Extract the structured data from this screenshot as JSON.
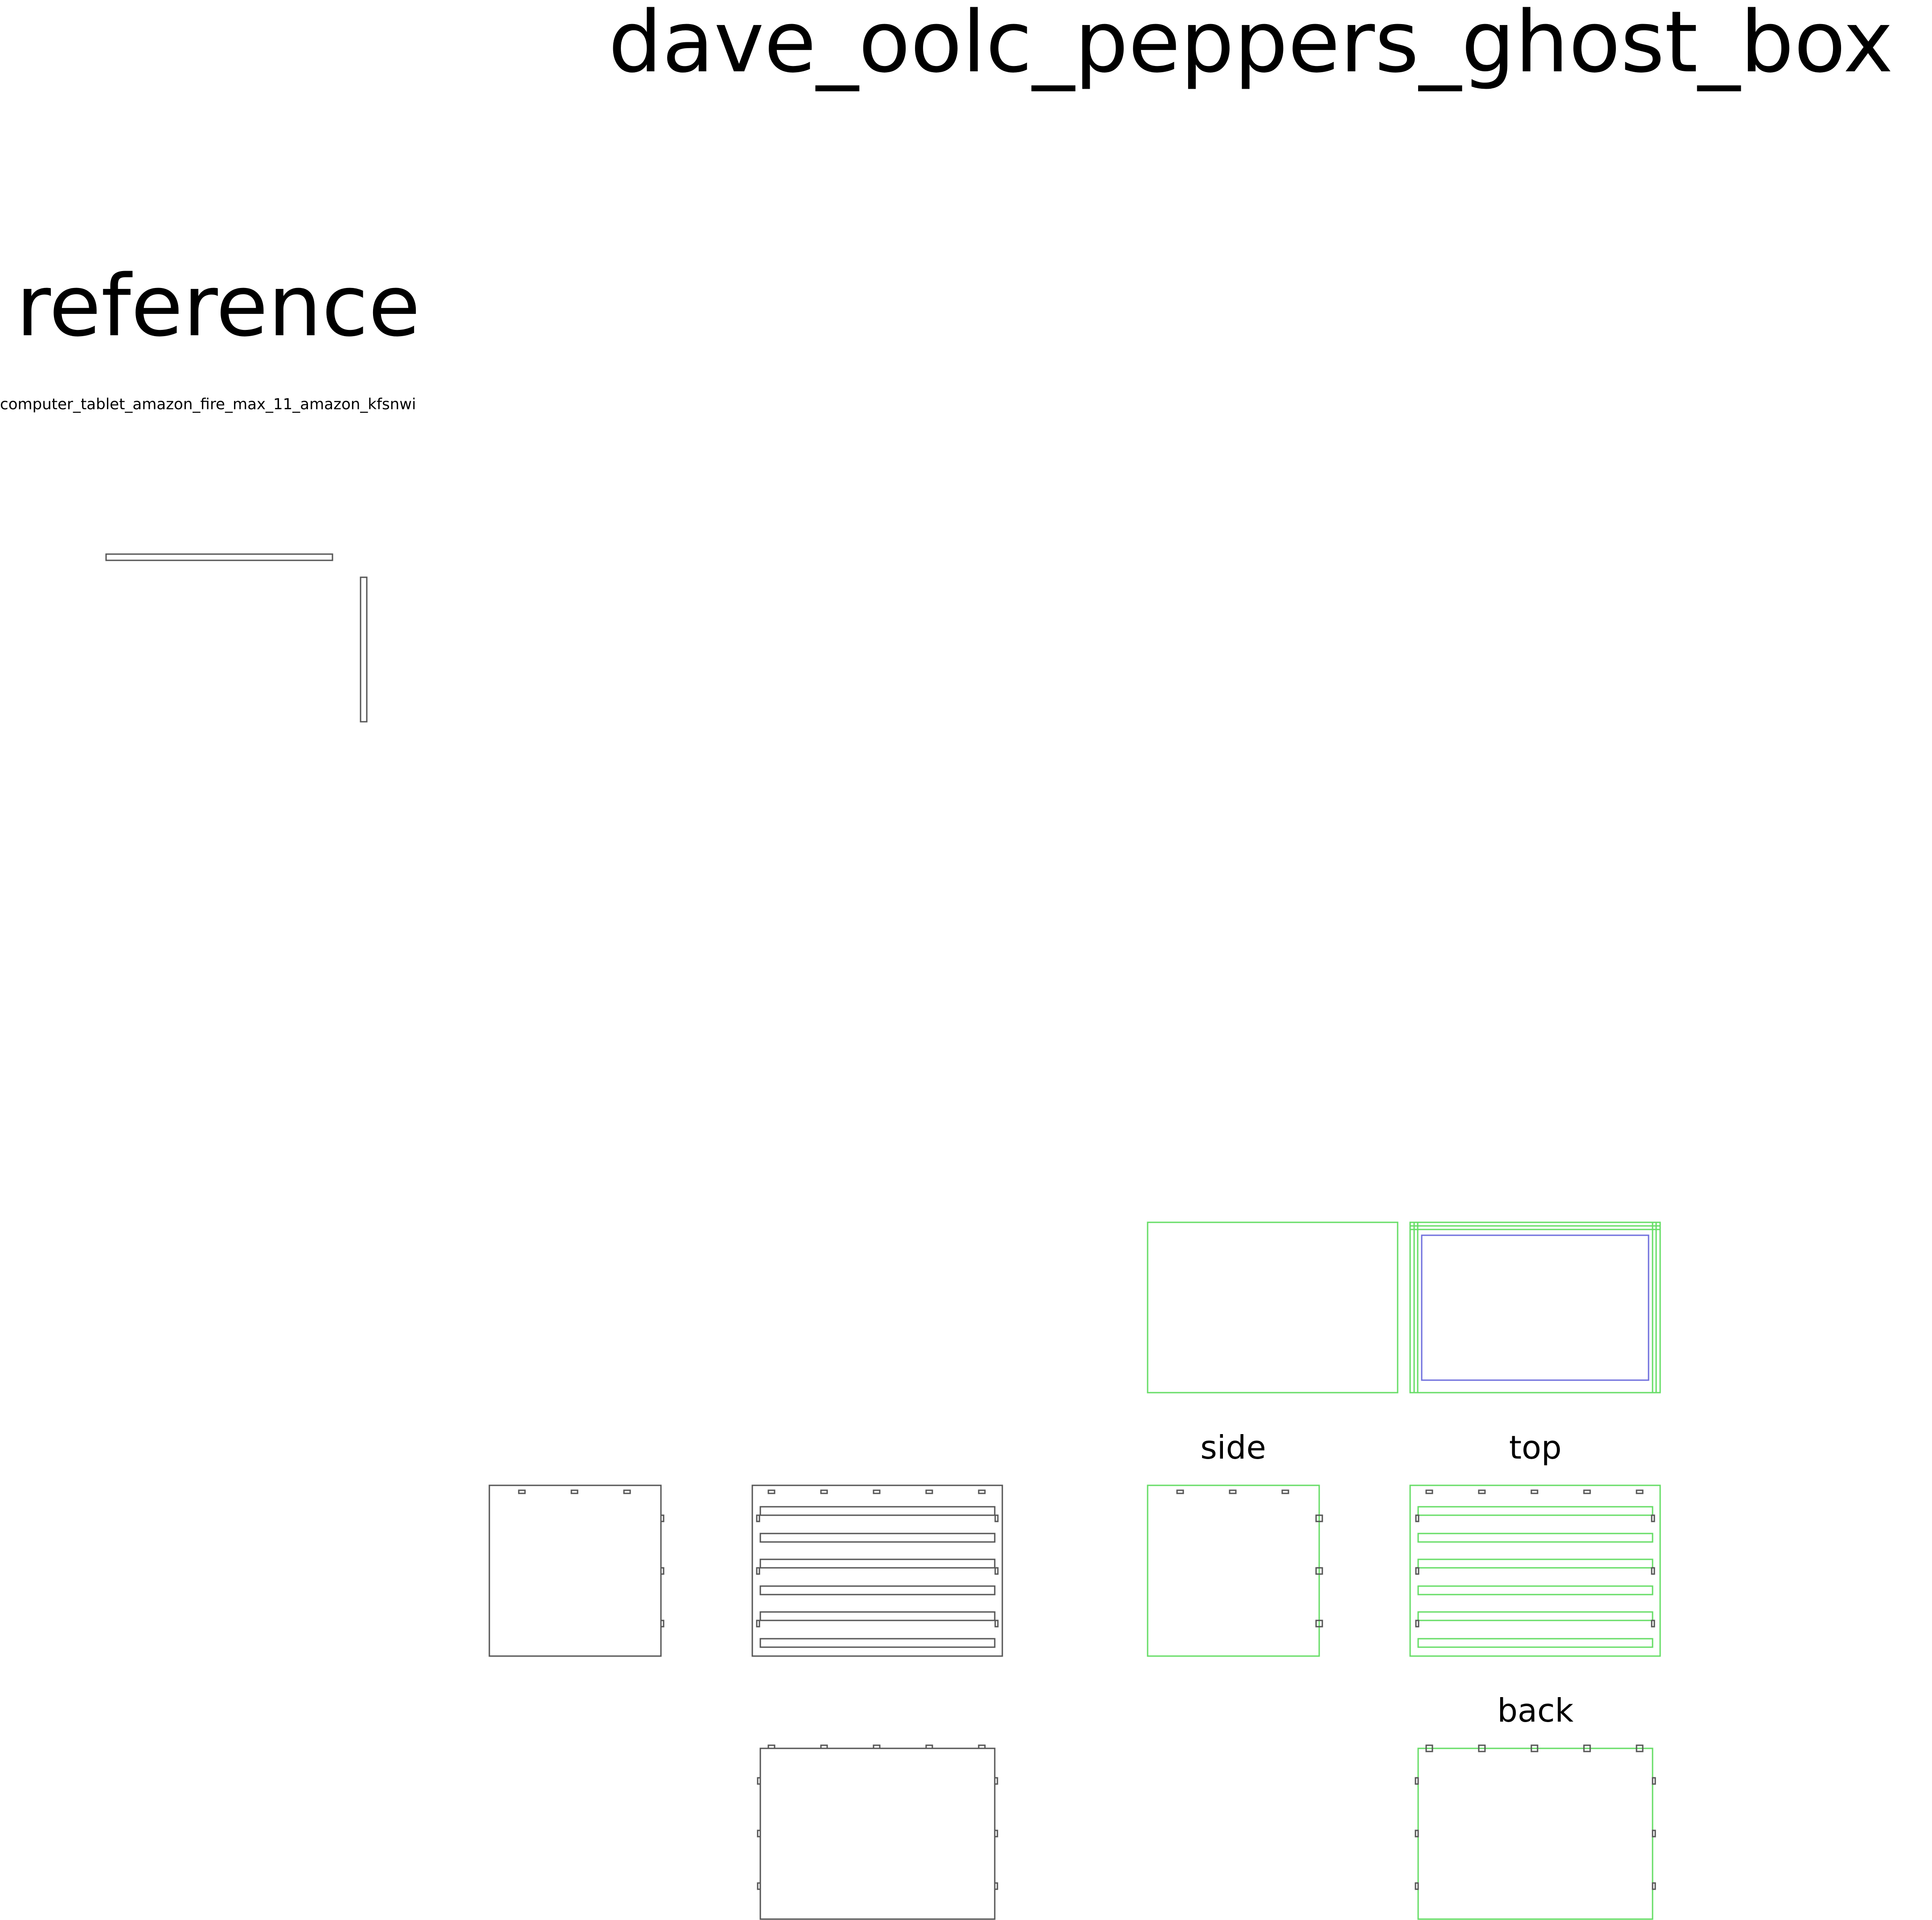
{
  "title": "dave_oolc_peppers_ghost_box",
  "reference": {
    "heading": "reference",
    "item": "computer_tablet_amazon_fire_max_11_amazon_kfsnwi"
  },
  "labels": {
    "side": "side",
    "top": "top",
    "back": "back"
  },
  "colors": {
    "cut_line": "#555555",
    "reference_line": "#66dd66",
    "screen_outline": "#6f6fdd"
  }
}
